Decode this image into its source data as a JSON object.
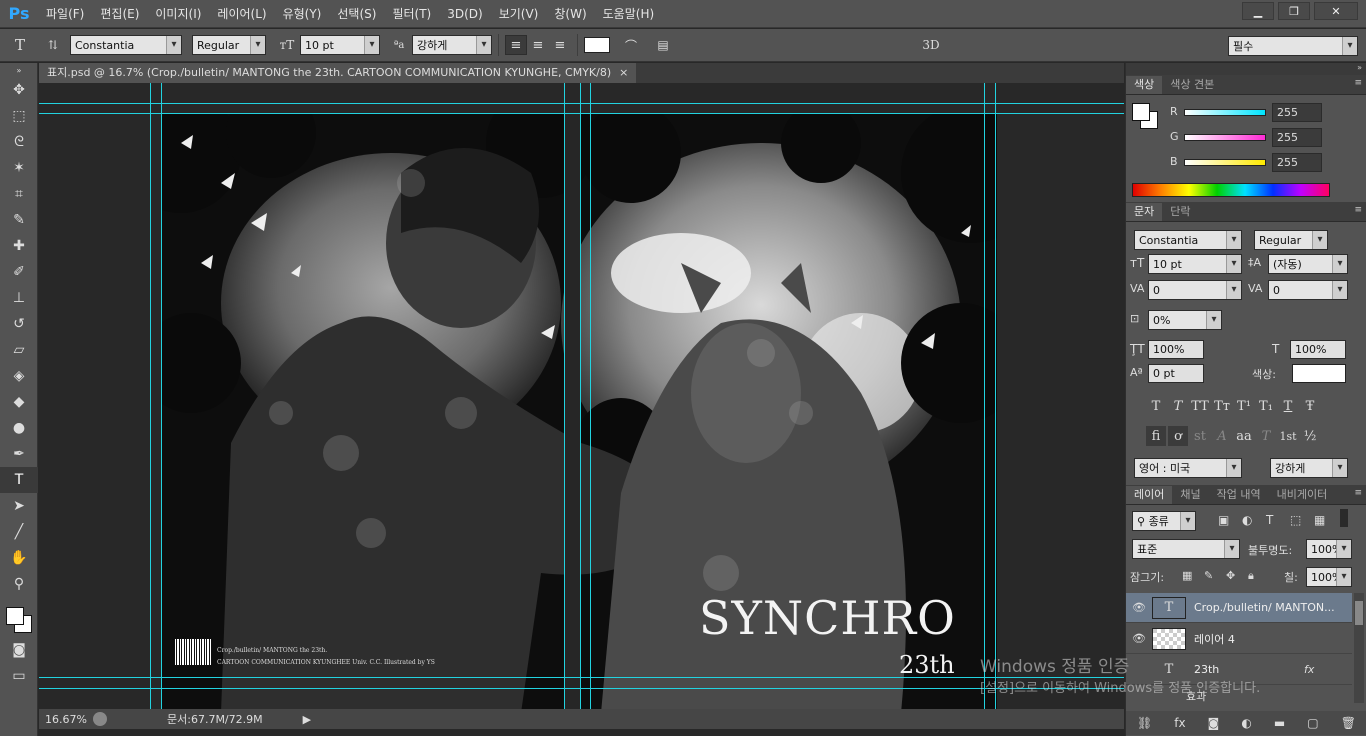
{
  "app": {
    "logo": "Ps"
  },
  "menu": [
    "파일(F)",
    "편집(E)",
    "이미지(I)",
    "레이어(L)",
    "유형(Y)",
    "선택(S)",
    "필터(T)",
    "3D(D)",
    "보기(V)",
    "창(W)",
    "도움말(H)"
  ],
  "window_controls": {
    "minimize": "▁",
    "restore": "❐",
    "close": "✕"
  },
  "options": {
    "font_family": "Constantia",
    "font_style": "Regular",
    "font_size": "10 pt",
    "anti_alias_label": "ªa",
    "anti_alias": "강하게",
    "threed_label": "3D",
    "workspace": "필수"
  },
  "document": {
    "tab_title": "표지.psd @ 16.7% (Crop./bulletin/ MANTONG the 23th. CARTOON COMMUNICATION KYUNGHE, CMYK/8)",
    "tab_close": "×",
    "art_title": "SYNCHRO",
    "art_edition": "23th",
    "credits_line1": "Crop./bulletin/ MANTONG the 23th.",
    "credits_line2": "CARTOON COMMUNICATION KYUNGHEE Univ. C.C. Illustrated by YS"
  },
  "status": {
    "zoom": "16.67%",
    "doc_info": "문서:67.7M/72.9M"
  },
  "color_panel": {
    "tabs": [
      "색상",
      "색상 견본"
    ],
    "channels": [
      {
        "label": "R",
        "value": "255",
        "color": "#00e5ff"
      },
      {
        "label": "G",
        "value": "255",
        "color": "#ff2bd5"
      },
      {
        "label": "B",
        "value": "255",
        "color": "#ffea00"
      }
    ]
  },
  "char_panel": {
    "tabs": [
      "문자",
      "단락"
    ],
    "font_family": "Constantia",
    "font_style": "Regular",
    "size": "10 pt",
    "leading": "(자동)",
    "kerning": "0",
    "tracking": "0",
    "tsume": "0%",
    "vscale": "100%",
    "hscale": "100%",
    "baseline": "0 pt",
    "color_label": "색상:",
    "type_buttons": [
      "T",
      "T",
      "TT",
      "Tт",
      "T¹",
      "T₁",
      "T",
      "Ŧ"
    ],
    "ot_buttons": [
      "fi",
      "ơ",
      "st",
      "A",
      "aa",
      "T",
      "1st",
      "½"
    ],
    "language": "영어 : 미국",
    "anti_alias": "강하게"
  },
  "layers_panel": {
    "tabs": [
      "레이어",
      "채널",
      "작업 내역",
      "내비게이터"
    ],
    "filter": "종류",
    "blend_mode": "표준",
    "opacity_label": "불투명도:",
    "opacity": "100%",
    "lock_label": "잠그기:",
    "fill_label": "칠:",
    "fill": "100%",
    "layers": [
      {
        "name": "Crop./bulletin/ MANTON...",
        "type": "T",
        "selected": true
      },
      {
        "name": "레이어 4",
        "type": "pixel",
        "selected": false
      },
      {
        "name": "23th",
        "type": "T",
        "selected": false,
        "fx": "fx"
      }
    ],
    "effects_label": "효과"
  },
  "watermark": {
    "line1": "Windows 정품 인증",
    "line2": "[설정]으로 이동하여 Windows를 정품 인증합니다."
  }
}
